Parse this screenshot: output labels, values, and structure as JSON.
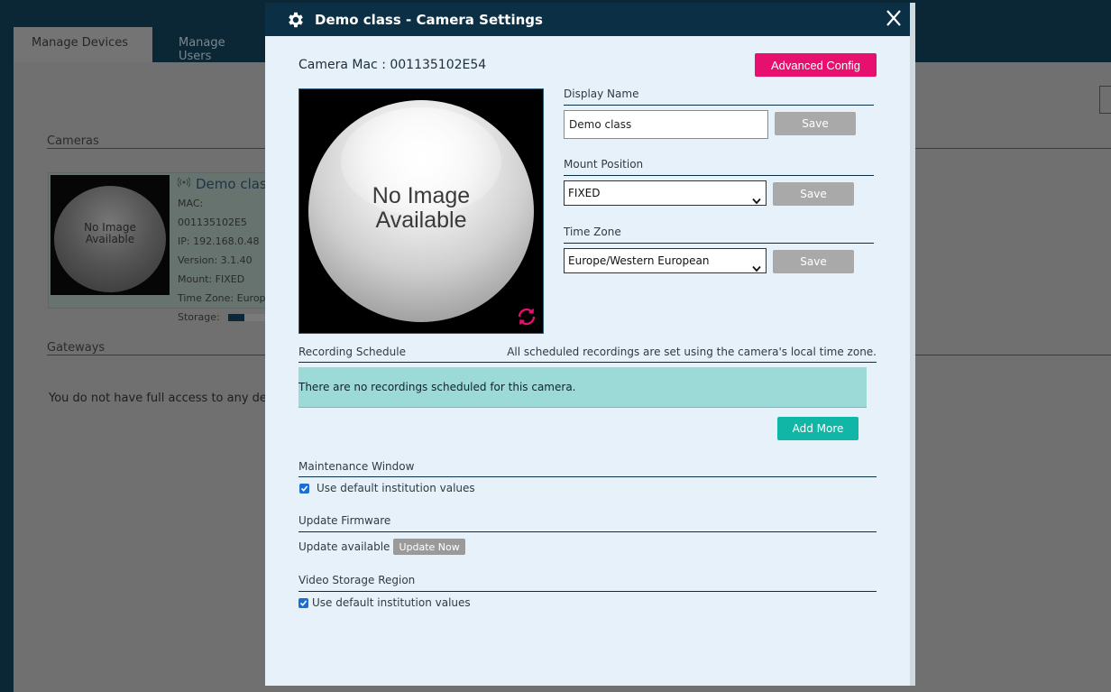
{
  "background": {
    "tabs": [
      {
        "label": "Manage Devices"
      },
      {
        "label": "Manage Users"
      }
    ],
    "cameras_heading": "Cameras",
    "gateways_heading": "Gateways",
    "gateways_message": "You do not have full access to any devi",
    "card": {
      "image_text_line1": "No Image",
      "image_text_line2": "Available",
      "title": "Demo clas",
      "mac": "MAC: 001135102E5",
      "ip": "IP: 192.168.0.48",
      "version": "Version: 3.1.40",
      "mount": "Mount: FIXED",
      "timezone": "Time Zone: Europ",
      "storage_label": "Storage:",
      "storage_used_fraction": 0.4
    }
  },
  "modal": {
    "title": "Demo class - Camera Settings",
    "icon": "gear-icon",
    "close_label": "X",
    "mac_label": "Camera Mac : 001135102E54",
    "advanced_button": "Advanced Config",
    "image_text_line1": "No Image",
    "image_text_line2": "Available",
    "display_name": {
      "label": "Display Name",
      "value": "Demo class",
      "save": "Save"
    },
    "mount_position": {
      "label": "Mount Position",
      "value": "FIXED",
      "save": "Save"
    },
    "time_zone": {
      "label": "Time Zone",
      "value": "Europe/Western European",
      "save": "Save"
    },
    "recording": {
      "label": "Recording Schedule",
      "note": "All scheduled recordings are set using the camera's local time zone.",
      "empty_message": "There are no recordings scheduled for this camera.",
      "add_button": "Add More"
    },
    "maintenance": {
      "label": "Maintenance Window",
      "checkbox_label": "Use default institution values",
      "checked": true
    },
    "firmware": {
      "label": "Update Firmware",
      "status": "Update available",
      "button": "Update Now"
    },
    "storage_region": {
      "label": "Video Storage Region",
      "checkbox_label": "Use default institution values",
      "checked": true
    },
    "colors": {
      "header": "#0b2f45",
      "accent_pink": "#e8106f",
      "accent_teal": "#12b6a6",
      "banner": "#9bdad7"
    }
  }
}
